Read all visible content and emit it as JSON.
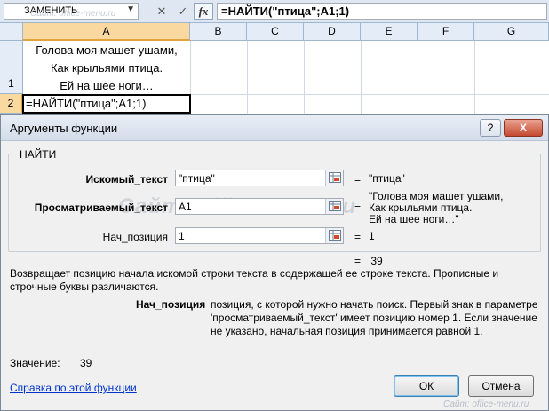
{
  "formula_bar": {
    "name_box": "ЗАМЕНИТЬ",
    "name_box_watermark": "Сайт: office-menu.ru",
    "formula": "=НАЙТИ(\"птица\";A1;1)",
    "fx_label": "fx",
    "cancel_glyph": "✕",
    "enter_glyph": "✓",
    "dropdown_glyph": "▼"
  },
  "sheet": {
    "columns": [
      "A",
      "B",
      "C",
      "D",
      "E",
      "F",
      "G"
    ],
    "rows": [
      "1",
      "2"
    ],
    "cell_A1_lines": [
      "Голова моя машет ушами,",
      "Как крыльями птица.",
      "Ей на шее ноги…"
    ],
    "cell_A2": "=НАЙТИ(\"птица\";A1;1)"
  },
  "dialog": {
    "title": "Аргументы функции",
    "help_glyph": "?",
    "close_glyph": "X",
    "function_name": "НАЙТИ",
    "args": [
      {
        "label": "Искомый_текст",
        "value": "\"птица\"",
        "result_lines": [
          "\"птица\""
        ]
      },
      {
        "label": "Просматриваемый_текст",
        "value": "A1",
        "result_lines": [
          "\"Голова моя машет ушами,",
          "Как крыльями птица.",
          "Ей на шее ноги…\""
        ]
      },
      {
        "label": "Нач_позиция",
        "value": "1",
        "result_lines": [
          "1"
        ]
      }
    ],
    "eq": "=",
    "formula_result": "39",
    "description": "Возвращает позицию начала искомой строки текста в содержащей ее строке текста. Прописные и строчные буквы различаются.",
    "param_name": "Нач_позиция",
    "param_description": "позиция, с которой нужно начать поиск. Первый знак в параметре 'просматриваемый_текст' имеет позицию номер 1. Если значение не указано, начальная позиция принимается равной 1.",
    "value_label": "Значение:",
    "value": "39",
    "help_link": "Справка по этой функции",
    "ok_label": "ОК",
    "cancel_label": "Отмена",
    "watermark": "Сайт: office-menu.ru",
    "footer_watermark": "Сайт: office-menu.ru"
  },
  "colors": {
    "header_bg": "#e4ecf7",
    "selected_header": "#f9d99f",
    "link": "#0033cc",
    "dialog_bg": "#f0f0f0"
  }
}
